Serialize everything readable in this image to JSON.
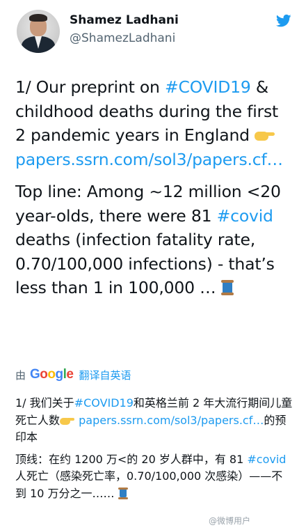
{
  "author": {
    "name": "Shamez Ladhani",
    "handle": "@ShamezLadhani"
  },
  "icons": {
    "logo": "twitter-bird-icon",
    "point": "backhand-index-pointing-right-emoji",
    "thread": "spool-of-thread-emoji"
  },
  "colors": {
    "link": "#1d9bf0",
    "secondary_text": "#536471"
  },
  "tweet": {
    "p1_text1": "1/ Our preprint on ",
    "p1_hashtag": "#COVID19",
    "p1_text2": " & childhood deaths during the first 2 pandemic years in England ",
    "p1_link": "papers.ssrn.com/sol3/papers.cf…",
    "p2_text1": "Top line: Among ~12 million <20 year-olds, there were 81 ",
    "p2_hashtag": "#covid",
    "p2_text2": " deaths (infection fatality rate, 0.70/100,000 infections) - that’s less than 1 in 100,000 … "
  },
  "translation_bar": {
    "by_label": "由",
    "provider": "Google",
    "from_label": "翻译自英语"
  },
  "translation": {
    "p1_text1": "1/ 我们关于",
    "p1_hashtag": "#COVID19",
    "p1_text2": "和英格兰前 2 年大流行期间儿童死亡人数",
    "p1_link": "papers.ssrn.com/sol3/papers.cf…",
    "p1_text3": "的预印本",
    "p2_text1": "顶线：在约 1200 万<的 20 岁人群中，有 81 ",
    "p2_hashtag": "#covid",
    "p2_text2": "人死亡（感染死亡率，0.70/100,000 次感染）——不到 10 万分之一…… "
  },
  "watermark": "@微博用户"
}
